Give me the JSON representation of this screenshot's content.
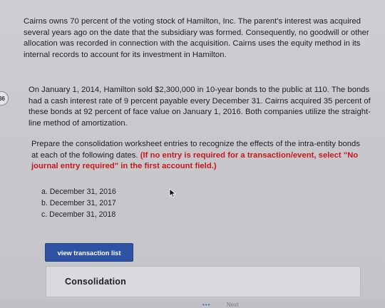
{
  "problem": {
    "number": "36",
    "intro": "Cairns owns 70 percent of the voting stock of Hamilton, Inc. The parent's interest was acquired several years ago on the date that the subsidiary was formed. Consequently, no goodwill or other allocation was recorded in connection with the acquisition. Cairns uses the equity method in its internal records to account for its investment in Hamilton.",
    "details": "On January 1, 2014, Hamilton sold $2,300,000 in 10-year bonds to the public at 110. The bonds had a cash interest rate of 9 percent payable every December 31. Cairns acquired 35 percent of these bonds at 92 percent of face value on January 1, 2016. Both companies utilize the straight-line method of amortization.",
    "instruction": "Prepare the consolidation worksheet entries to recognize the effects of the intra-entity bonds at each of the following dates.",
    "instruction_note": "(If no entry is required for a transaction/event, select \"No journal entry required\" in the first account field.)",
    "parts": [
      "a. December 31, 2016",
      "b. December 31, 2017",
      "c. December 31, 2018"
    ]
  },
  "actions": {
    "view_transaction_list": "view transaction list"
  },
  "panel": {
    "title": "Consolidation"
  },
  "footer": {
    "dots": "•••",
    "next_label": "Next"
  }
}
